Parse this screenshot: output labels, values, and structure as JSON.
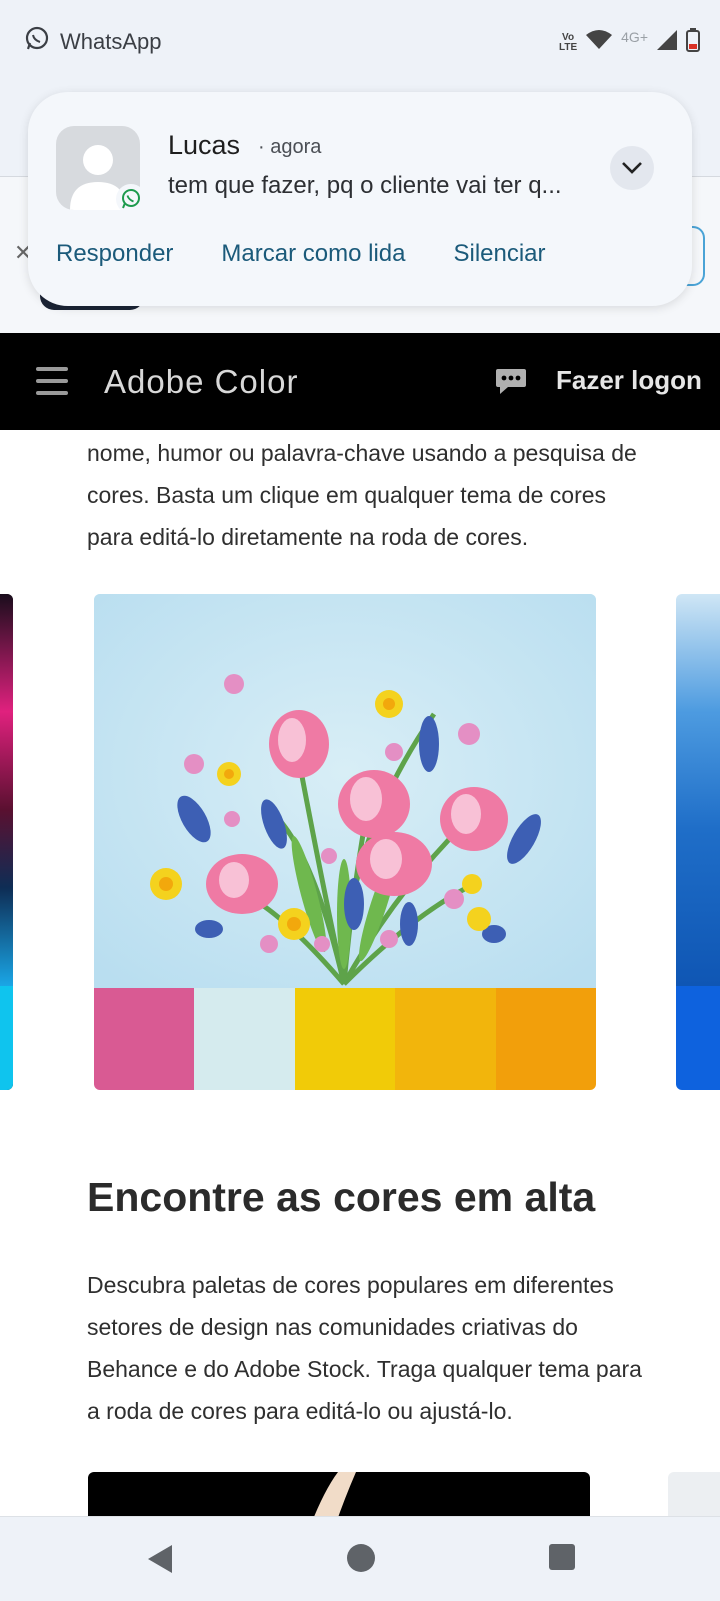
{
  "status_bar": {
    "app_name": "WhatsApp",
    "volte_top": "Vo",
    "volte_bottom": "LTE",
    "network": "4G+"
  },
  "notification": {
    "sender": "Lucas",
    "time": "· agora",
    "message": "tem que fazer, pq o cliente vai ter q...",
    "actions": [
      "Responder",
      "Marcar como lida",
      "Silenciar"
    ]
  },
  "header": {
    "title": "Adobe Color",
    "login_label": "Fazer logon"
  },
  "intro": {
    "text": "nome, humor ou palavra-chave usando a pesquisa de cores. Basta um clique em qualquer tema de cores para editá-lo diretamente na roda de cores."
  },
  "theme_card": {
    "swatches": [
      "#d95a93",
      "#d5ebee",
      "#f1cb08",
      "#f2b50c",
      "#f29f0b"
    ]
  },
  "section": {
    "heading": "Encontre as cores em alta",
    "text": "Descubra paletas de cores populares em diferentes setores de design nas comunidades criativas do Behance e do Adobe Stock. Traga qualquer tema para a roda de cores para editá-lo ou ajustá-lo."
  }
}
